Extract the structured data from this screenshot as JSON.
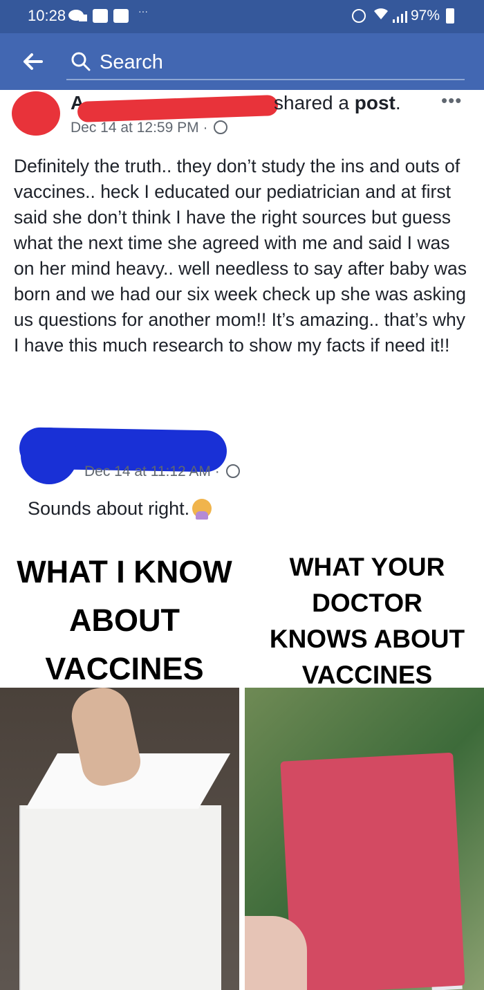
{
  "status_bar": {
    "time": "10:28",
    "dots": "···",
    "battery": "97%"
  },
  "top_bar": {
    "search_placeholder": "Search"
  },
  "post": {
    "author_visible_letter": "A",
    "action_text": "shared a ",
    "action_object": "post",
    "action_end": ".",
    "timestamp": "Dec 14 at 12:59 PM",
    "separator": "·",
    "more": "•••",
    "body": "Definitely the truth.. they don’t study the ins and outs of vaccines.. heck I educated our pediatrician and at first said she don’t think I have the right sources but guess what the next time she agreed with me and said I was on her mind heavy.. well needless to say after baby was born and we had our six week check up she was asking us questions for another mom!! It’s amazing.. that’s why I have this much research to show my facts if need it!!"
  },
  "comment": {
    "timestamp": "Dec 14 at 11:12 AM",
    "separator": "·",
    "text": "Sounds about right."
  },
  "meme": {
    "left_caption": [
      "WHAT I KNOW",
      "ABOUT",
      "VACCINES"
    ],
    "right_caption": [
      "WHAT YOUR",
      "DOCTOR",
      "KNOWS ABOUT",
      "VACCINES"
    ]
  },
  "colors": {
    "status_bar_bg": "#35589b",
    "top_bar_bg": "#4267b2",
    "redaction_red": "#e8333a",
    "redaction_blue": "#1930d6",
    "text_primary": "#1d2129",
    "text_meta": "#606770"
  }
}
